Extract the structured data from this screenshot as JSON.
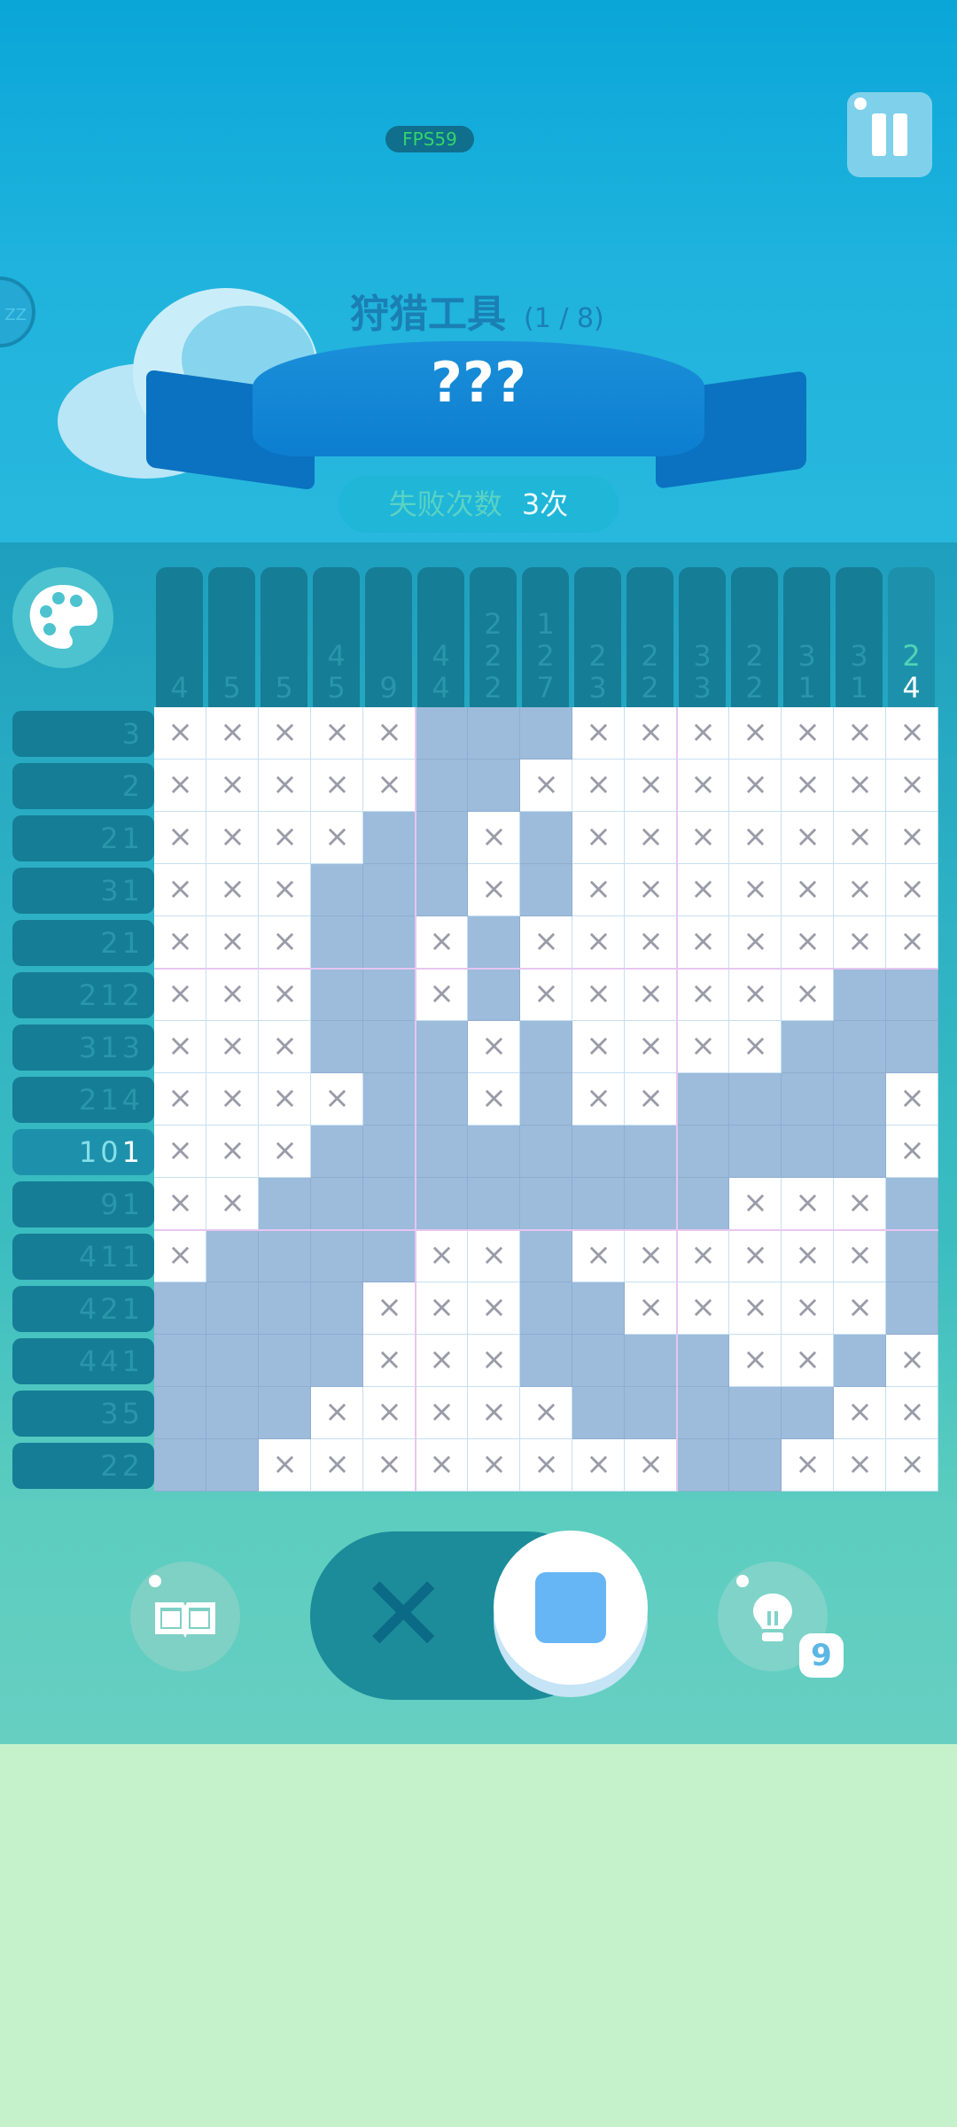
{
  "top": {
    "fps": "FPS59",
    "zz": "ZZ"
  },
  "level": {
    "title": "狩猎工具",
    "progress": "(1 / 8)",
    "banner": "???"
  },
  "fail": {
    "label": "失败次数",
    "count": "3次"
  },
  "puzzle": {
    "columns": [
      [
        "4"
      ],
      [
        "5"
      ],
      [
        "5"
      ],
      [
        "4",
        "5"
      ],
      [
        "9"
      ],
      [
        "4",
        "4"
      ],
      [
        "2",
        "2",
        "2"
      ],
      [
        "1",
        "2",
        "7"
      ],
      [
        "2",
        "3"
      ],
      [
        "2",
        "2"
      ],
      [
        "3",
        "3"
      ],
      [
        "2",
        "2"
      ],
      [
        "3",
        "1"
      ],
      [
        "3",
        "1"
      ],
      [
        "2",
        "4"
      ]
    ],
    "rows": [
      [
        "3"
      ],
      [
        "2"
      ],
      [
        "2",
        "1"
      ],
      [
        "3",
        "1"
      ],
      [
        "2",
        "1"
      ],
      [
        "2",
        "1",
        "2"
      ],
      [
        "3",
        "1",
        "3"
      ],
      [
        "2",
        "1",
        "4"
      ],
      [
        "10",
        "1"
      ],
      [
        "9",
        "1"
      ],
      [
        "4",
        "1",
        "1"
      ],
      [
        "4",
        "2",
        "1"
      ],
      [
        "4",
        "4",
        "1"
      ],
      [
        "3",
        "5"
      ],
      [
        "2",
        "2"
      ]
    ],
    "active_row": 8,
    "active_col": 14,
    "cells": [
      "XXXXX...XXXXXXX",
      "XXXXX..XXXXXXXX",
      "XXXX..X.XXXXXXX",
      "XXX...X.XXXXXXX",
      "XXX..X.XXXXXXXX",
      "XXX..X.XXXXXX..",
      "XXX...X.XXXX...",
      "XXXX..X.XX....X",
      "XXX...........X",
      "XX.........XXX.",
      "X....XX.XXXXXX.",
      "....XXX..XXXXX.",
      "....XXX....XX.X",
      "...XXXXX.....XX",
      "..XXXXXXXX..XXX"
    ]
  },
  "controls": {
    "book_icon": "book-icon",
    "mode": "fill",
    "hint_count": "9"
  },
  "colors": {
    "filled": "#9dbbdb",
    "active_clue": "#ffffff",
    "accent": "#66b6f5"
  }
}
